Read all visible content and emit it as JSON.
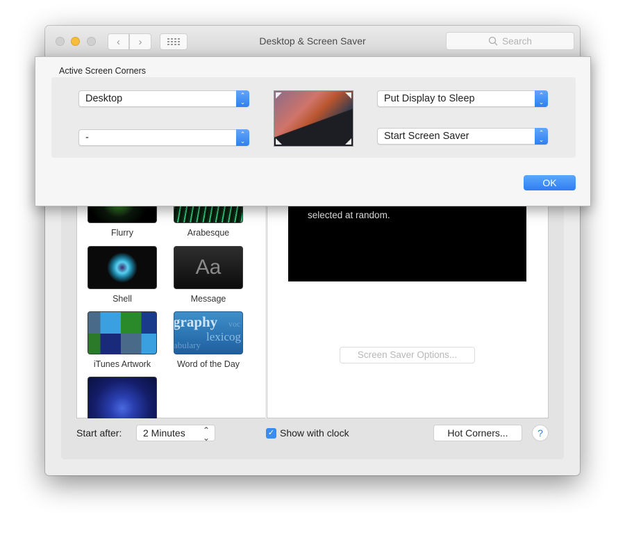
{
  "window": {
    "title": "Desktop & Screen Saver",
    "search_placeholder": "Search",
    "nav": {
      "back_icon": "chevron-left",
      "forward_icon": "chevron-right",
      "grid_icon": "show-all-grid"
    }
  },
  "sheet": {
    "title": "Active Screen Corners",
    "corners": {
      "top_left": "Desktop",
      "bottom_left": "-",
      "top_right": "Put Display to Sleep",
      "bottom_right": "Start Screen Saver"
    },
    "ok_label": "OK"
  },
  "savers": [
    {
      "name": "Flurry"
    },
    {
      "name": "Arabesque"
    },
    {
      "name": "Shell"
    },
    {
      "name": "Message",
      "thumb_text": "Aa"
    },
    {
      "name": "iTunes Artwork"
    },
    {
      "name": "Word of the Day",
      "thumb_words": [
        "graphy",
        "lexicog",
        "abulary",
        "voc"
      ]
    },
    {
      "name": ""
    }
  ],
  "preview": {
    "text": "selected at random.",
    "options_label": "Screen Saver Options..."
  },
  "footer": {
    "start_after_label": "Start after:",
    "start_after_value": "2 Minutes",
    "show_clock_label": "Show with clock",
    "show_clock_checked": true,
    "hot_corners_label": "Hot Corners...",
    "help_label": "?"
  },
  "colors": {
    "accent": "#3b8cf0",
    "minimize": "#f6bd3b"
  }
}
